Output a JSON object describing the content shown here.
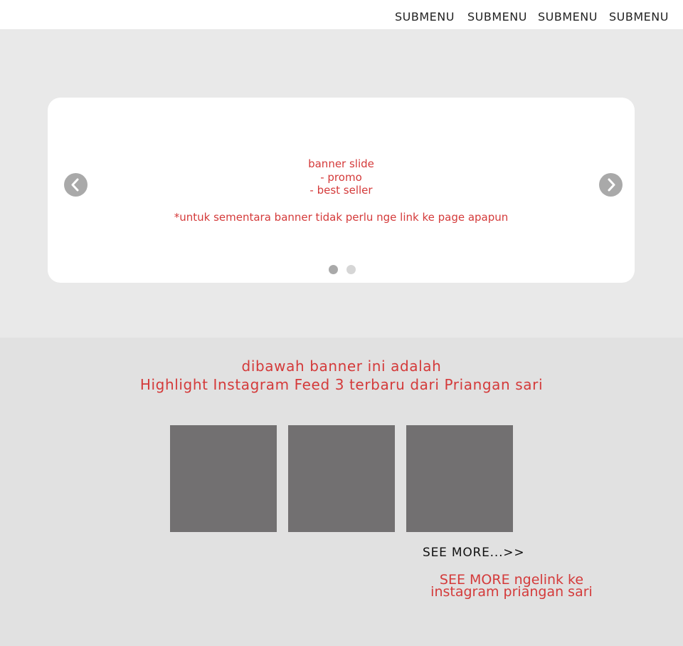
{
  "nav": {
    "items": [
      {
        "label": "SUBMENU"
      },
      {
        "label": "SUBMENU"
      },
      {
        "label": "SUBMENU"
      },
      {
        "label": "SUBMENU"
      }
    ]
  },
  "banner": {
    "lines": [
      "banner slide",
      "- promo",
      "- best seller"
    ],
    "note": "*untuk sementara banner tidak perlu nge link ke page apapun",
    "prev_icon": "chevron-left-icon",
    "next_icon": "chevron-right-icon",
    "slide_count": 2,
    "active_slide": 1
  },
  "feed": {
    "heading_line1": "dibawah banner ini adalah",
    "heading_line2": "Highlight Instagram Feed 3 terbaru dari Priangan sari",
    "tile_count": 3,
    "see_more_label": "SEE MORE...>>",
    "note_line1": "SEE MORE ngelink ke",
    "note_line2": "instagram priangan sari"
  },
  "colors": {
    "annotation_red": "#d43a3a",
    "tile_gray": "#727071",
    "hero_bg": "#e9e9e9",
    "section_bg": "#e1e1e1"
  }
}
